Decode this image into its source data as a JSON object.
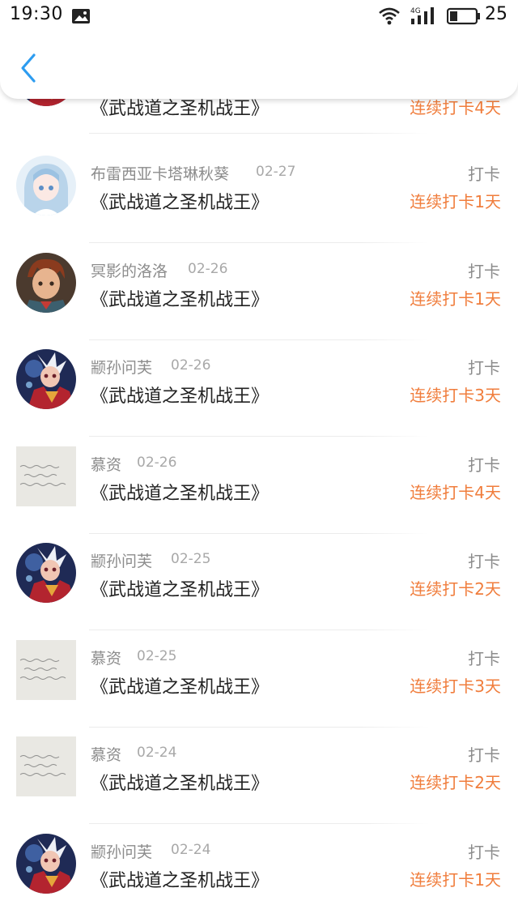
{
  "status_bar": {
    "time": "19:30",
    "battery": "25"
  },
  "nav": {},
  "partial_row": {
    "streak": "连续打卡4天"
  },
  "rows": [
    {
      "user": "布雷西亚卡塔琳秋葵",
      "date": "02-27",
      "title": "《武战道之圣机战王》",
      "action": "打卡",
      "streak": "连续打卡1天",
      "avatar": "anime-girl-avatar"
    },
    {
      "user": "冥影的洛洛",
      "date": "02-26",
      "title": "《武战道之圣机战王》",
      "action": "打卡",
      "streak": "连续打卡1天",
      "avatar": "cartoon-boy-avatar"
    },
    {
      "user": "颛孙问芙",
      "date": "02-26",
      "title": "《武战道之圣机战王》",
      "action": "打卡",
      "streak": "连续打卡3天",
      "avatar": "hero-character-avatar"
    },
    {
      "user": "慕资",
      "date": "02-26",
      "title": "《武战道之圣机战王》",
      "action": "打卡",
      "streak": "连续打卡4天",
      "avatar": "handwriting-note-avatar"
    },
    {
      "user": "颛孙问芙",
      "date": "02-25",
      "title": "《武战道之圣机战王》",
      "action": "打卡",
      "streak": "连续打卡2天",
      "avatar": "hero-character-avatar"
    },
    {
      "user": "慕资",
      "date": "02-25",
      "title": "《武战道之圣机战王》",
      "action": "打卡",
      "streak": "连续打卡3天",
      "avatar": "handwriting-note-avatar"
    },
    {
      "user": "慕资",
      "date": "02-24",
      "title": "《武战道之圣机战王》",
      "action": "打卡",
      "streak": "连续打卡2天",
      "avatar": "handwriting-note-avatar"
    },
    {
      "user": "颛孙问芙",
      "date": "02-24",
      "title": "《武战道之圣机战王》",
      "action": "打卡",
      "streak": "连续打卡1天",
      "avatar": "hero-character-avatar"
    }
  ],
  "colors": {
    "accent": "#f07d3c",
    "back_arrow": "#2d9cf0",
    "muted_text": "#8c8c8c",
    "title_text": "#222222"
  }
}
